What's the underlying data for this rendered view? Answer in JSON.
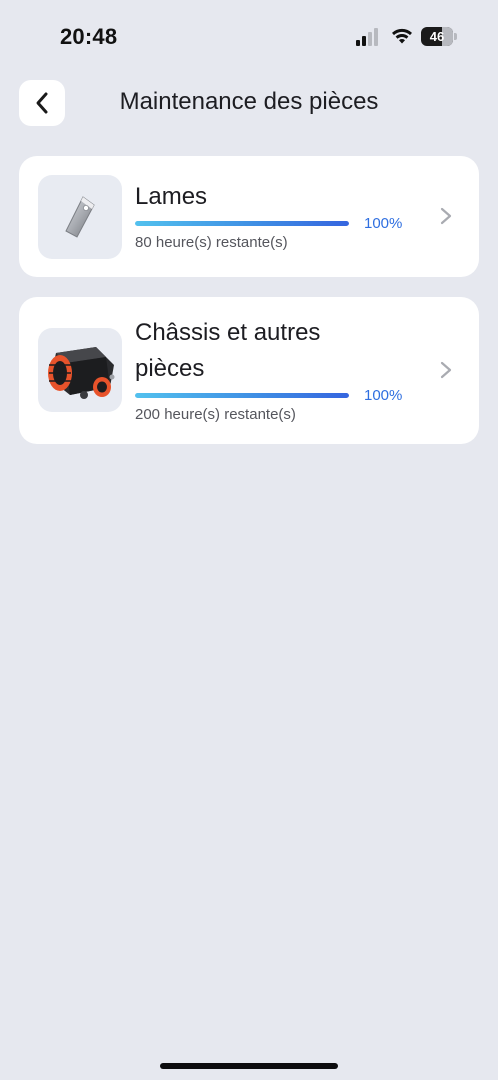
{
  "status_bar": {
    "time": "20:48",
    "battery_level": "46",
    "icons": [
      "signal-icon",
      "wifi-icon",
      "battery-icon"
    ]
  },
  "header": {
    "title": "Maintenance des pièces",
    "back_icon": "chevron-left-icon"
  },
  "parts": [
    {
      "name": "Lames",
      "progress_percent": 100,
      "progress_label": "100%",
      "remaining": "80 heure(s) restante(s)",
      "thumbnail": "blade-image",
      "chevron": "chevron-right-icon"
    },
    {
      "name": "Châssis et autres pièces",
      "progress_percent": 100,
      "progress_label": "100%",
      "remaining": "200 heure(s) restante(s)",
      "thumbnail": "mower-chassis-image",
      "chevron": "chevron-right-icon"
    }
  ],
  "colors": {
    "background": "#e6e8ef",
    "card": "#ffffff",
    "accent_blue": "#2f6fe0",
    "progress_start": "#52c1ee",
    "progress_end": "#3565df",
    "mower_orange": "#e8532b"
  }
}
